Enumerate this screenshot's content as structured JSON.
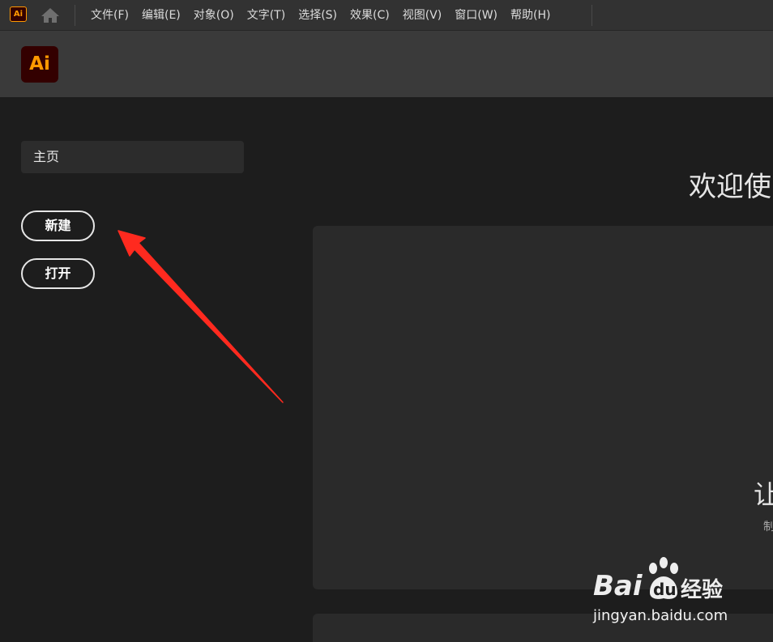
{
  "app": {
    "badge_label": "Ai",
    "logo_label": "Ai",
    "accent_color": "#ff9a00",
    "logo_bg_color": "#330000"
  },
  "menubar": {
    "items": [
      "文件(F)",
      "编辑(E)",
      "对象(O)",
      "文字(T)",
      "选择(S)",
      "效果(C)",
      "视图(V)",
      "窗口(W)",
      "帮助(H)"
    ]
  },
  "icons": {
    "home": "home-icon",
    "arrow": "red-arrow-annotation"
  },
  "sidebar": {
    "home_label": "主页",
    "new_label": "新建",
    "open_label": "打开"
  },
  "main": {
    "welcome_title": "欢迎使",
    "hero_heading": "让",
    "hero_sub": "制"
  },
  "annotation": {
    "arrow_color": "#ff2a1f"
  },
  "watermark": {
    "logo_bai": "Bai",
    "logo_du": "du",
    "logo_jingyan": "经验",
    "url": "jingyan.baidu.com"
  }
}
